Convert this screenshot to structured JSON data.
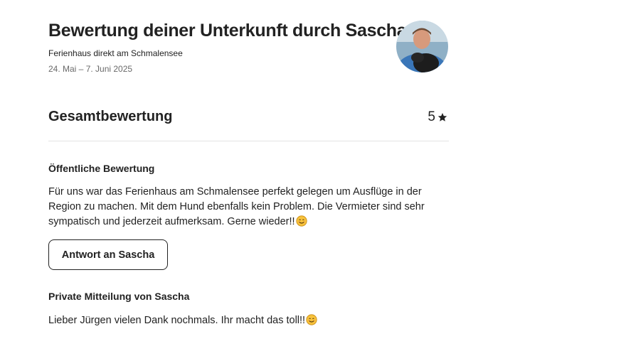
{
  "header": {
    "title": "Bewertung deiner Unterkunft durch Sascha",
    "listing_name": "Ferienhaus direkt am Schmalensee",
    "dates": "24. Mai – 7. Juni 2025"
  },
  "overall": {
    "label": "Gesamtbewertung",
    "score": "5"
  },
  "public_review": {
    "heading": "Öffentliche Bewertung",
    "text": "Für uns war das Ferienhaus am Schmalensee perfekt gelegen um Ausflüge in der Region zu machen. Mit dem Hund ebenfalls kein Problem. Die Vermieter sind sehr sympatisch und jederzeit aufmerksam. Gerne wieder!!",
    "emoji": "smiling-face-icon"
  },
  "reply_button": {
    "label": "Antwort an Sascha"
  },
  "private_message": {
    "heading": "Private Mitteilung von Sascha",
    "text": "Lieber Jürgen vielen Dank nochmals. Ihr macht das toll!!",
    "emoji": "smiling-face-icon"
  },
  "colors": {
    "text_primary": "#222222",
    "text_secondary": "#6a6a6a",
    "divider": "#e3e3e3"
  }
}
